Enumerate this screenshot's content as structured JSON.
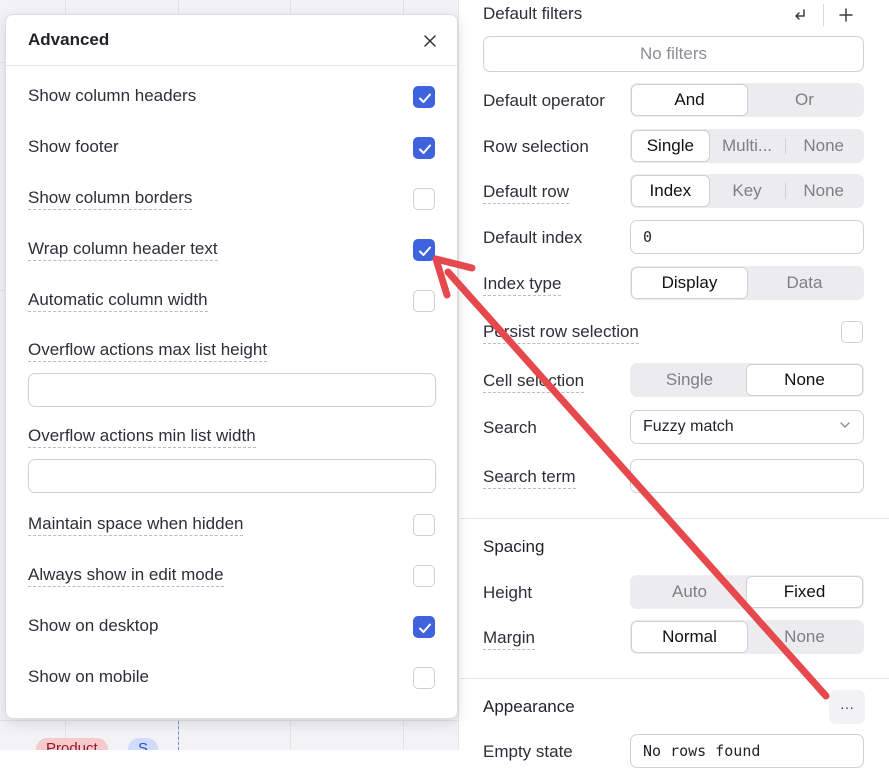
{
  "canvas": {
    "tags": [
      "Product",
      "S"
    ]
  },
  "panel": {
    "default_filters": {
      "label": "Default filters",
      "empty": "No filters"
    },
    "default_operator": {
      "label": "Default operator",
      "options": [
        "And",
        "Or"
      ]
    },
    "row_selection": {
      "label": "Row selection",
      "options": [
        "Single",
        "Multi...",
        "None"
      ]
    },
    "default_row": {
      "label": "Default row",
      "options": [
        "Index",
        "Key",
        "None"
      ]
    },
    "default_index": {
      "label": "Default index",
      "value": "0"
    },
    "index_type": {
      "label": "Index type",
      "options": [
        "Display",
        "Data"
      ]
    },
    "persist_row_selection": {
      "label": "Persist row selection",
      "checked": false
    },
    "cell_selection": {
      "label": "Cell selection",
      "options": [
        "Single",
        "None"
      ]
    },
    "search": {
      "label": "Search",
      "value": "Fuzzy match"
    },
    "search_term": {
      "label": "Search term",
      "value": ""
    },
    "spacing": {
      "title": "Spacing"
    },
    "height": {
      "label": "Height",
      "options": [
        "Auto",
        "Fixed"
      ]
    },
    "margin": {
      "label": "Margin",
      "options": [
        "Normal",
        "None"
      ]
    },
    "appearance": {
      "title": "Appearance",
      "more": "···"
    },
    "empty_state": {
      "label": "Empty state",
      "value": "No rows found"
    }
  },
  "advanced": {
    "title": "Advanced",
    "items": [
      {
        "label": "Show column headers",
        "checked": true
      },
      {
        "label": "Show footer",
        "checked": true
      },
      {
        "label": "Show column borders",
        "checked": false
      },
      {
        "label": "Wrap column header text",
        "checked": true
      },
      {
        "label": "Automatic column width",
        "checked": false
      }
    ],
    "overflow_max": {
      "label": "Overflow actions max list height",
      "value": ""
    },
    "overflow_min": {
      "label": "Overflow actions min list width",
      "value": ""
    },
    "items2": [
      {
        "label": "Maintain space when hidden",
        "checked": false
      },
      {
        "label": "Always show in edit mode",
        "checked": false
      },
      {
        "label": "Show on desktop",
        "checked": true
      },
      {
        "label": "Show on mobile",
        "checked": false
      }
    ]
  },
  "colors": {
    "accent": "#3e63dd",
    "annotation_arrow": "#e5484d"
  }
}
